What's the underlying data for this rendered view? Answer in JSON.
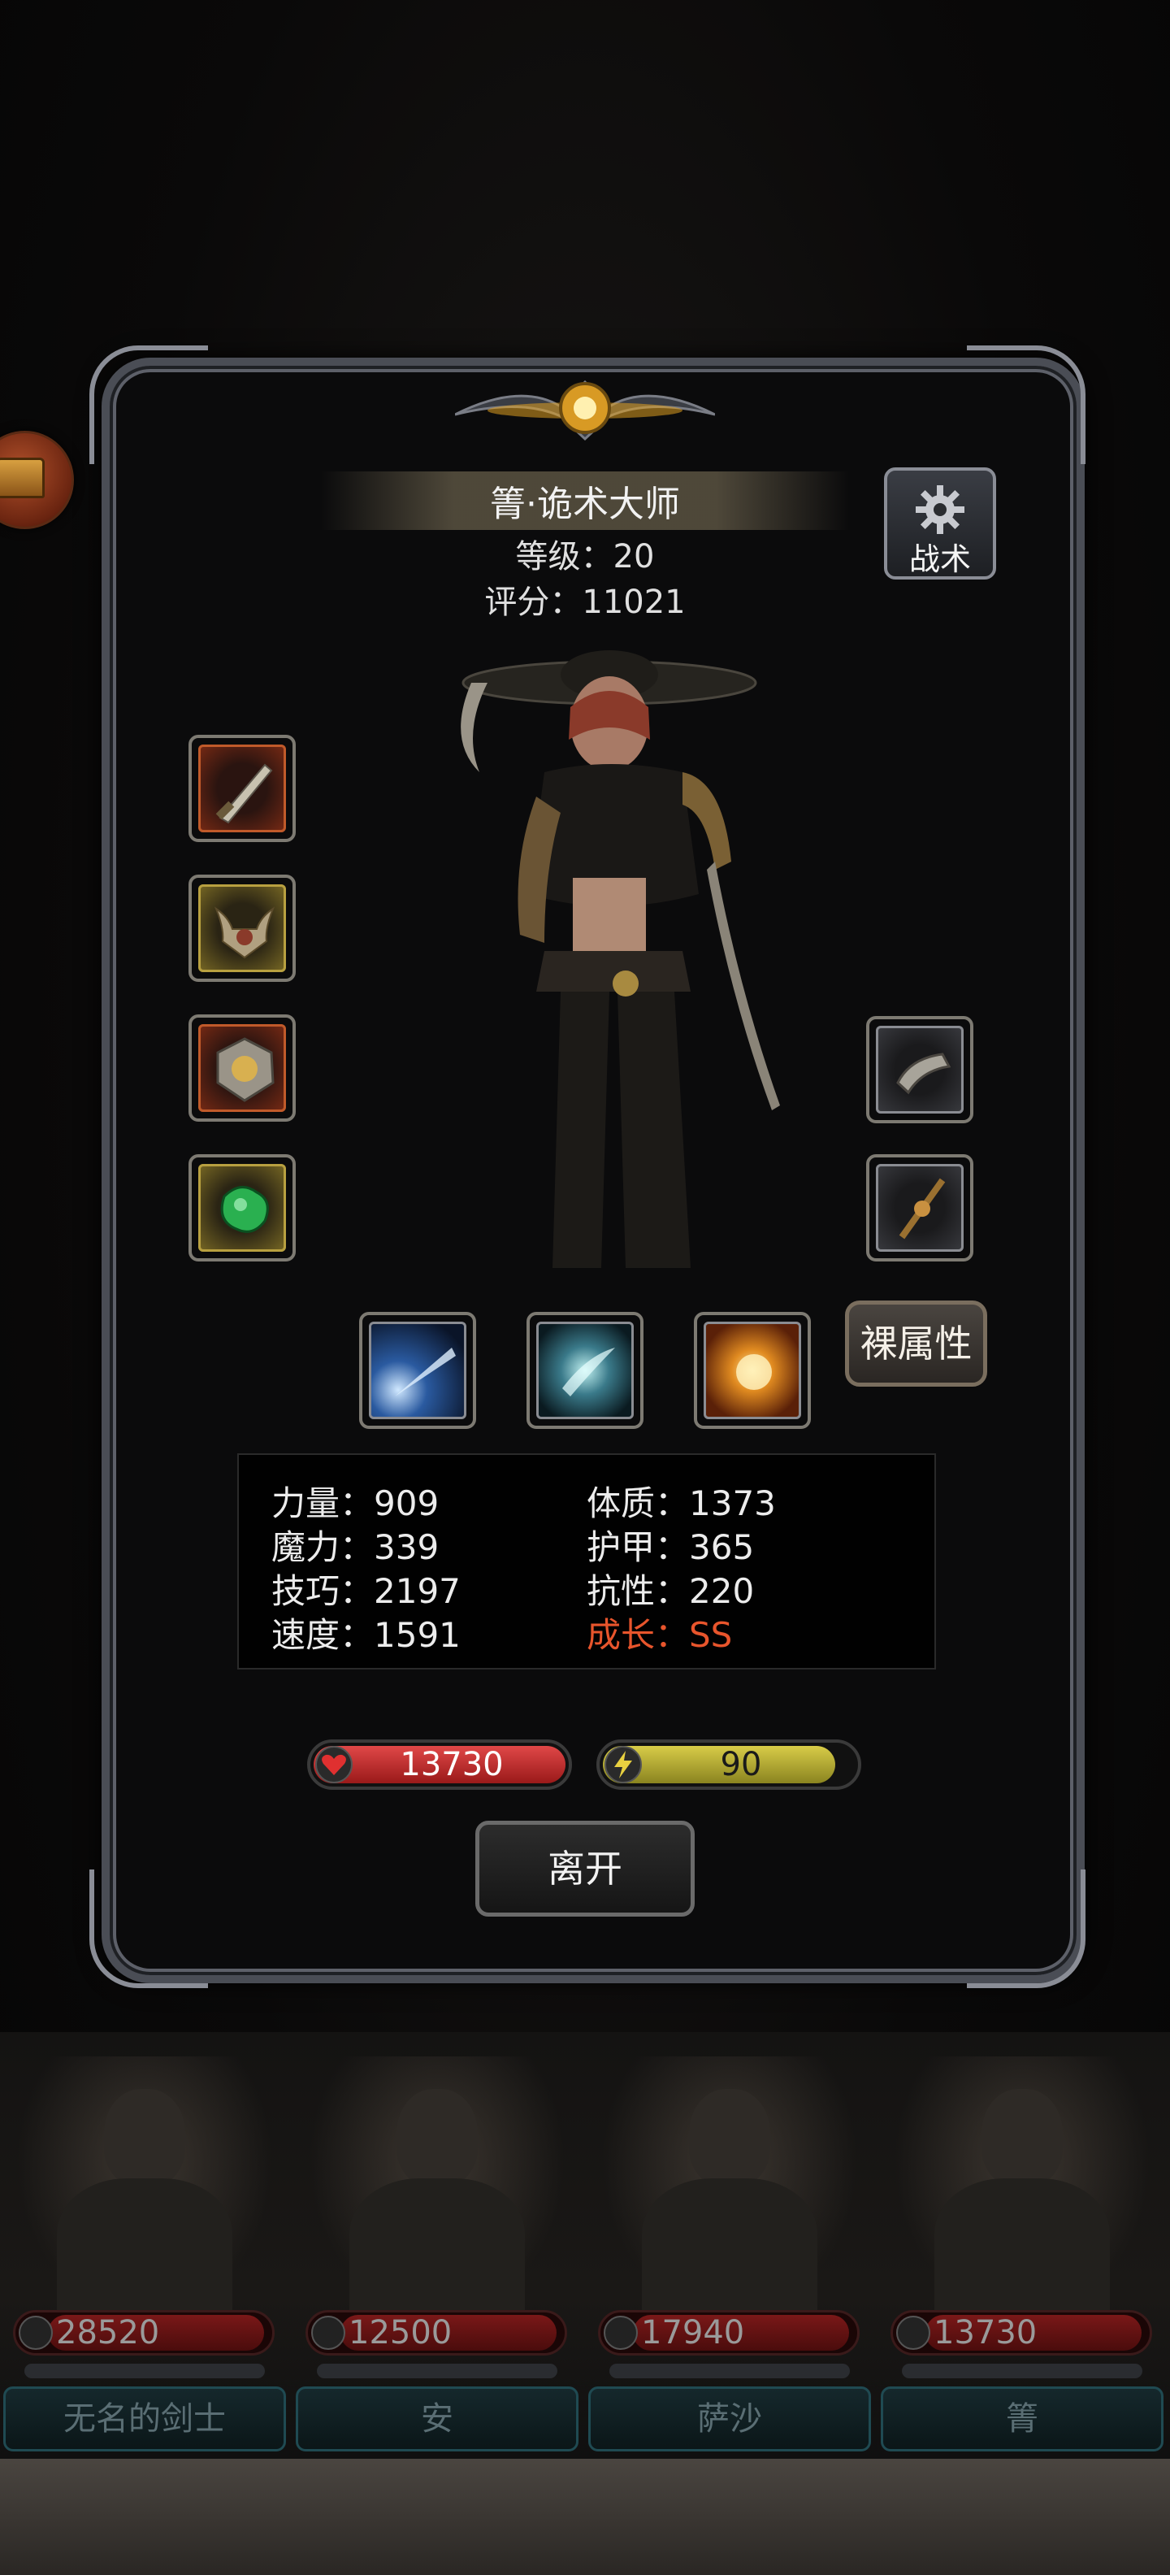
{
  "hero": {
    "name": "箐·诡术大师",
    "level": "等级：20",
    "score": "评分：11021"
  },
  "buttons": {
    "tactics": "战术",
    "naked_attributes": "裸属性",
    "leave": "离开"
  },
  "stats": {
    "strength": "力量：909",
    "magic": "魔力：339",
    "skill": "技巧：2197",
    "speed": "速度：1591",
    "constitution": "体质：1373",
    "armor": "护甲：365",
    "resistance": "抗性：220",
    "growth": "成长：SS"
  },
  "bars": {
    "hp": "13730",
    "energy": "90",
    "energy_fraction": 0.92
  },
  "equipment_left": [
    {
      "icon": "dagger-icon",
      "rarity_color": "#c05a2a"
    },
    {
      "icon": "helmet-icon",
      "rarity_color": "#b8a040"
    },
    {
      "icon": "amulet-icon",
      "rarity_color": "#c05a2a"
    },
    {
      "icon": "green-gem-icon",
      "rarity_color": "#b8a040"
    }
  ],
  "equipment_right": [
    {
      "icon": "bracer-icon",
      "rarity_color": "#8a8c92"
    },
    {
      "icon": "staff-icon",
      "rarity_color": "#8a8c92"
    }
  ],
  "skills": [
    {
      "icon": "blue-beam-skill-icon"
    },
    {
      "icon": "ice-slash-skill-icon"
    },
    {
      "icon": "fire-burst-skill-icon"
    }
  ],
  "roster": [
    {
      "name": "无名的剑士",
      "hp": "28520"
    },
    {
      "name": "安",
      "hp": "12500"
    },
    {
      "name": "萨沙",
      "hp": "17940"
    },
    {
      "name": "箐",
      "hp": "13730"
    }
  ],
  "colors": {
    "growth": "#e8552c",
    "hp_bar": "#c83030",
    "energy_bar": "#c8bc40",
    "roster_name_border": "#1f4a52"
  }
}
